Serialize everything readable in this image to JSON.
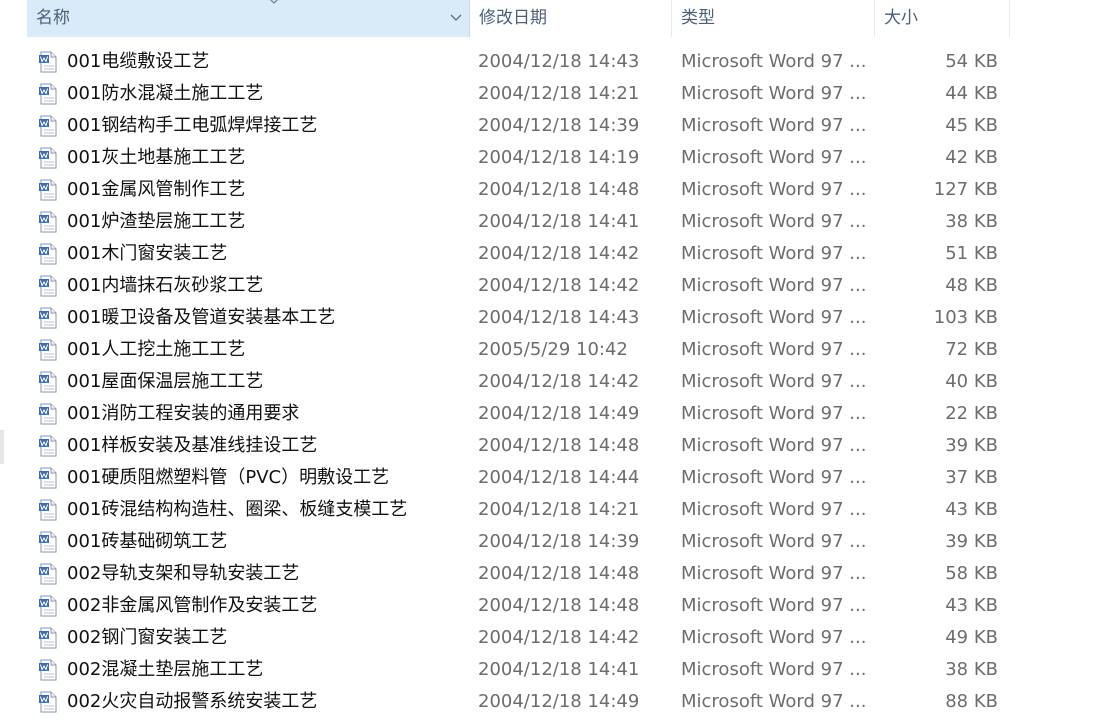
{
  "columns": {
    "name": "名称",
    "date": "修改日期",
    "type": "类型",
    "size": "大小"
  },
  "icons": {
    "sort": "sort-arrow-icon",
    "column_menu": "chevron-down-icon",
    "file": "word-document-icon"
  },
  "files": [
    {
      "name": "001电缆敷设工艺",
      "date": "2004/12/18 14:43",
      "type": "Microsoft Word 97 ...",
      "size": "54 KB"
    },
    {
      "name": "001防水混凝土施工工艺",
      "date": "2004/12/18 14:21",
      "type": "Microsoft Word 97 ...",
      "size": "44 KB"
    },
    {
      "name": "001钢结构手工电弧焊焊接工艺",
      "date": "2004/12/18 14:39",
      "type": "Microsoft Word 97 ...",
      "size": "45 KB"
    },
    {
      "name": "001灰土地基施工工艺",
      "date": "2004/12/18 14:19",
      "type": "Microsoft Word 97 ...",
      "size": "42 KB"
    },
    {
      "name": "001金属风管制作工艺",
      "date": "2004/12/18 14:48",
      "type": "Microsoft Word 97 ...",
      "size": "127 KB"
    },
    {
      "name": "001炉渣垫层施工工艺",
      "date": "2004/12/18 14:41",
      "type": "Microsoft Word 97 ...",
      "size": "38 KB"
    },
    {
      "name": "001木门窗安装工艺",
      "date": "2004/12/18 14:42",
      "type": "Microsoft Word 97 ...",
      "size": "51 KB"
    },
    {
      "name": "001内墙抹石灰砂浆工艺",
      "date": "2004/12/18 14:42",
      "type": "Microsoft Word 97 ...",
      "size": "48 KB"
    },
    {
      "name": "001暖卫设备及管道安装基本工艺",
      "date": "2004/12/18 14:43",
      "type": "Microsoft Word 97 ...",
      "size": "103 KB"
    },
    {
      "name": "001人工挖土施工工艺",
      "date": "2005/5/29 10:42",
      "type": "Microsoft Word 97 ...",
      "size": "72 KB"
    },
    {
      "name": "001屋面保温层施工工艺",
      "date": "2004/12/18 14:42",
      "type": "Microsoft Word 97 ...",
      "size": "40 KB"
    },
    {
      "name": "001消防工程安装的通用要求",
      "date": "2004/12/18 14:49",
      "type": "Microsoft Word 97 ...",
      "size": "22 KB"
    },
    {
      "name": "001样板安装及基准线挂设工艺",
      "date": "2004/12/18 14:48",
      "type": "Microsoft Word 97 ...",
      "size": "39 KB"
    },
    {
      "name": "001硬质阻燃塑料管（PVC）明敷设工艺",
      "date": "2004/12/18 14:44",
      "type": "Microsoft Word 97 ...",
      "size": "37 KB"
    },
    {
      "name": "001砖混结构构造柱、圈梁、板缝支模工艺",
      "date": "2004/12/18 14:21",
      "type": "Microsoft Word 97 ...",
      "size": "43 KB"
    },
    {
      "name": "001砖基础砌筑工艺",
      "date": "2004/12/18 14:39",
      "type": "Microsoft Word 97 ...",
      "size": "39 KB"
    },
    {
      "name": "002导轨支架和导轨安装工艺",
      "date": "2004/12/18 14:48",
      "type": "Microsoft Word 97 ...",
      "size": "58 KB"
    },
    {
      "name": "002非金属风管制作及安装工艺",
      "date": "2004/12/18 14:48",
      "type": "Microsoft Word 97 ...",
      "size": "43 KB"
    },
    {
      "name": "002钢门窗安装工艺",
      "date": "2004/12/18 14:42",
      "type": "Microsoft Word 97 ...",
      "size": "49 KB"
    },
    {
      "name": "002混凝土垫层施工工艺",
      "date": "2004/12/18 14:41",
      "type": "Microsoft Word 97 ...",
      "size": "38 KB"
    },
    {
      "name": "002火灾自动报警系统安装工艺",
      "date": "2004/12/18 14:49",
      "type": "Microsoft Word 97 ...",
      "size": "88 KB"
    }
  ]
}
